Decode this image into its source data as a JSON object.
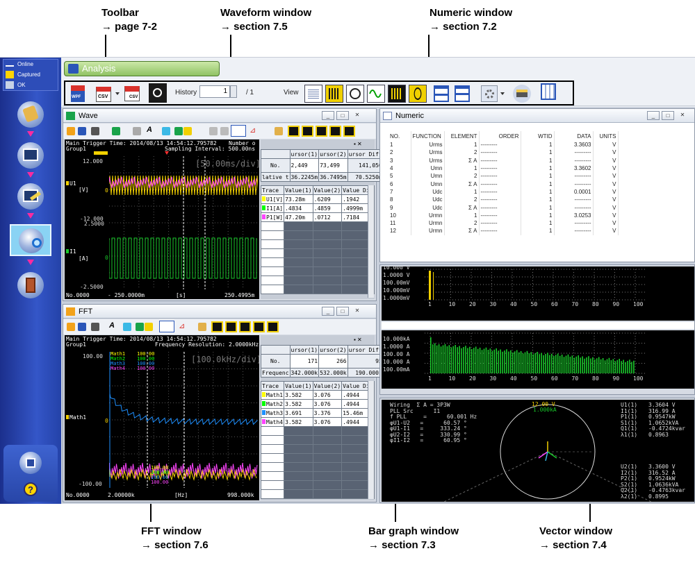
{
  "callouts": {
    "toolbar": {
      "title": "Toolbar",
      "ref": "→ page 7-2"
    },
    "waveform": {
      "title": "Waveform window",
      "ref": "→ section 7.5"
    },
    "numeric": {
      "title": "Numeric window",
      "ref": "→ section 7.2"
    },
    "fft": {
      "title": "FFT window",
      "ref": "→ section 7.6"
    },
    "bargraph": {
      "title": "Bar graph window",
      "ref": "→ section 7.3"
    },
    "vector": {
      "title": "Vector window",
      "ref": "→ section 7.4"
    }
  },
  "sidebar": {
    "status": [
      {
        "label": "Online",
        "icon": "online-icon"
      },
      {
        "label": "Captured",
        "icon": "captured-icon"
      },
      {
        "label": "OK",
        "icon": "ok-icon"
      }
    ],
    "steps": [
      "connect-step",
      "measure-step",
      "edit-step",
      "analysis-step",
      "exit-step"
    ],
    "bottom": [
      "save-icon",
      "help-icon"
    ]
  },
  "app": {
    "tab_title": "Analysis",
    "history_label": "History",
    "history_value": "1",
    "history_total": "/ 1",
    "view_label": "View",
    "csv": "CSV",
    "wpf": "WPF"
  },
  "wave": {
    "title": "Wave",
    "header1": "Main  Trigger Time: 2014/08/13 14:54:12.795782",
    "header1b": "Number o",
    "header2": "Group1",
    "header2b": "Sampling Interval: 500.00ns",
    "timediv": "[50.00ms/div]",
    "u1_top": "12.000",
    "u1_zero": "0",
    "u1_bot": "-12.000",
    "i1_top": "2.5000",
    "i1_zero": "0",
    "i1_bot": "-2.5000",
    "u1_name": "U1",
    "u1_unit": "[V]",
    "i1_name": "I1",
    "i1_unit": "[A]",
    "x_no": "No.0000",
    "x_start": "- 250.0000m",
    "x_unit": "[s]",
    "x_end": "250.4995m",
    "cursor_headers": [
      "ursor(1)",
      "ursor(2)",
      "ursor Diff"
    ],
    "cursor_no": [
      "No.",
      "2,449",
      "73,499",
      "141,050"
    ],
    "cursor_rel": [
      "lative t",
      "36.2245m",
      "36.7495m",
      "70.5250m"
    ],
    "trace_headers": [
      "Trace",
      "Value(1)",
      "Value(2)",
      "Value Dif"
    ],
    "traces": [
      {
        "name": "U1[V]",
        "v1": "73.28m",
        "v2": ".6209",
        "d": ".1942",
        "color": "#ffff00"
      },
      {
        "name": "I1[A]",
        "v1": ".4834",
        "v2": ".4859",
        "d": ".4999m",
        "color": "#00ff00"
      },
      {
        "name": "P1[W]",
        "v1": "47.20m",
        "v2": ".0712",
        "d": ".7184",
        "color": "#ff44ff"
      }
    ]
  },
  "fft": {
    "title": "FFT",
    "header1": "Main  Trigger Time: 2014/08/13 14:54:12.795782",
    "header2": "Group1",
    "header2b": "Frequency Resolution: 2.0000kHz",
    "freqdiv": "[100.0kHz/div]",
    "y_top": "100.00",
    "y_zero": "0",
    "y_bot": "-100.00",
    "ch_label": "Math1",
    "x_no": "No.0000",
    "x_start": "2.00000k",
    "x_unit": "[Hz]",
    "x_end": "998.000k",
    "legend": [
      {
        "name": "Math1",
        "val": "100.00",
        "color": "#ffff00"
      },
      {
        "name": "Math2",
        "val": "100.00",
        "color": "#00ff00"
      },
      {
        "name": "Math3",
        "val": "100.00",
        "color": "#1e90ff"
      },
      {
        "name": "Math4",
        "val": "100.00",
        "color": "#ff44ff"
      }
    ],
    "bottom_vals": [
      "100.00",
      "100.00",
      "100.00",
      "100.00"
    ],
    "cursor_headers": [
      "ursor(1)",
      "ursor(2)",
      "ursor Diff"
    ],
    "cursor_no": [
      "No.",
      "171",
      "266",
      "95"
    ],
    "cursor_freq": [
      "Frequenc",
      "342.000k",
      "532.000k",
      "190.000k"
    ],
    "trace_headers": [
      "Trace",
      "Value(1)",
      "Value(2)",
      "Value Dif"
    ],
    "traces": [
      {
        "name": "Math1",
        "v1": "3.582",
        "v2": "3.076",
        ".": "x",
        "d": ".4944",
        "color": "#ffff00"
      },
      {
        "name": "Math2",
        "v1": "3.582",
        "v2": "3.076",
        "d": ".4944",
        "color": "#00ff00"
      },
      {
        "name": "Math3",
        "v1": "3.691",
        "v2": "3.376",
        "d": "15.46m",
        "color": "#1e90ff"
      },
      {
        "name": "Math4",
        "v1": "3.582",
        "v2": "3.076",
        "d": ".4944",
        "color": "#ff44ff"
      }
    ]
  },
  "numeric": {
    "title": "Numeric",
    "headers": [
      "NO.",
      "FUNCTION",
      "ELEMENT",
      "ORDER",
      "WTID",
      "DATA",
      "UNITS"
    ],
    "rows": [
      [
        "1",
        "Urms",
        "1",
        "---------",
        "1",
        "3.3603",
        "V"
      ],
      [
        "2",
        "Urms",
        "2",
        "---------",
        "1",
        "---------",
        "V"
      ],
      [
        "3",
        "Urms",
        "Σ A",
        "---------",
        "1",
        "---------",
        "V"
      ],
      [
        "4",
        "Umn",
        "1",
        "---------",
        "1",
        "3.3602",
        "V"
      ],
      [
        "5",
        "Umn",
        "2",
        "---------",
        "1",
        "---------",
        "V"
      ],
      [
        "6",
        "Umn",
        "Σ A",
        "---------",
        "1",
        "---------",
        "V"
      ],
      [
        "7",
        "Udc",
        "1",
        "---------",
        "1",
        "0.0001",
        "V"
      ],
      [
        "8",
        "Udc",
        "2",
        "---------",
        "1",
        "---------",
        "V"
      ],
      [
        "9",
        "Udc",
        "Σ A",
        "---------",
        "1",
        "---------",
        "V"
      ],
      [
        "10",
        "Urmn",
        "1",
        "---------",
        "1",
        "3.0253",
        "V"
      ],
      [
        "11",
        "Urmn",
        "2",
        "---------",
        "1",
        "---------",
        "V"
      ],
      [
        "12",
        "Urmn",
        "Σ A",
        "---------",
        "1",
        "---------",
        "V"
      ]
    ]
  },
  "bar": {
    "top_labels": [
      "10.000 V",
      "1.0000 V",
      "100.00mV",
      "10.000mV",
      "1.0000mV"
    ],
    "bottom_labels": [
      "10.000kA",
      "1.0000 A",
      "100.00 A",
      "10.000 A",
      "100.00mA"
    ],
    "x_ticks": [
      "1",
      "10",
      "20",
      "30",
      "40",
      "50",
      "60",
      "70",
      "80",
      "90",
      "100"
    ]
  },
  "vector": {
    "left": [
      "Wiring  Σ A = 3P3W",
      "PLL Src      I1",
      "f PLL     =      60.001 Hz",
      "φU1-U2   =      60.57 °",
      "φU1-I1   =     333.24 °",
      "φU2-I2   =     330.99 °",
      "φI1-I2   =      60.95 °"
    ],
    "range_v": "12.00 V",
    "range_a": "1.000kA",
    "right_top": [
      [
        "U1(1)",
        "3.3604 V"
      ],
      [
        "I1(1)",
        "316.99 A"
      ],
      [
        "P1(1)",
        "0.9547kW"
      ],
      [
        "S1(1)",
        "1.0652kVA"
      ],
      [
        "Q1(1)",
        "-0.4724kvar"
      ],
      [
        "λ1(1)",
        "0.8963"
      ]
    ],
    "right_bot": [
      [
        "U2(1)",
        "3.3600 V"
      ],
      [
        "I2(1)",
        "316.52 A"
      ],
      [
        "P2(1)",
        "0.9524kW"
      ],
      [
        "S2(1)",
        "1.0636kVA"
      ],
      [
        "Q2(1)",
        "-0.4763kvar"
      ],
      [
        "λ2(1)",
        "0.8995"
      ]
    ]
  }
}
